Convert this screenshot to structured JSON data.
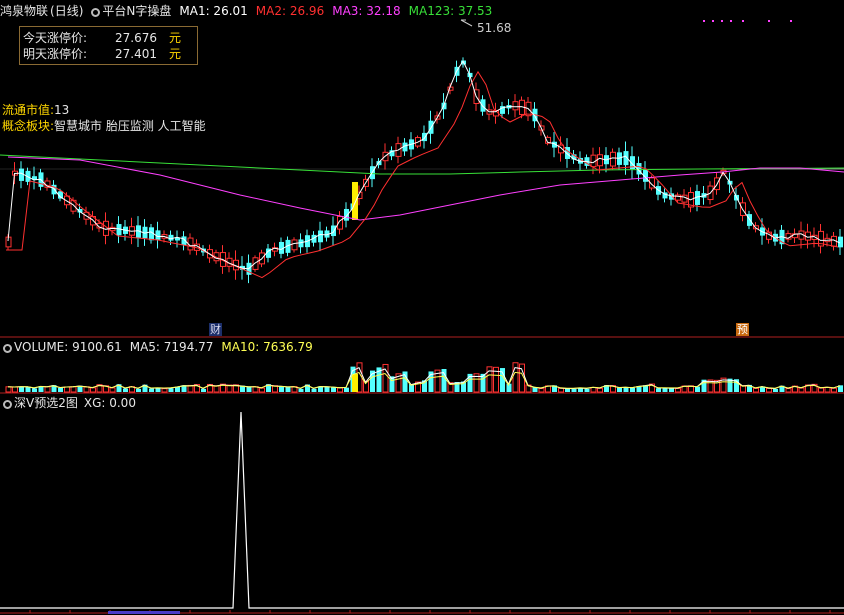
{
  "header": {
    "stock_name": "鸿泉物联",
    "period": "(日线)",
    "indicator_name": "平台N字操盘",
    "ma1": "MA1: 26.01",
    "ma2": "MA2: 26.96",
    "ma3": "MA3: 32.18",
    "ma123": "MA123: 37.53"
  },
  "limit_box": {
    "today_label": "今天涨停价:",
    "today_value": "27.676",
    "tomorrow_label": "明天涨停价:",
    "tomorrow_value": "27.401",
    "unit": "元"
  },
  "info": {
    "float_cap_label": "流通市值:",
    "float_cap_value": "13",
    "concept_label": "概念板块:",
    "concept_value": "智慧城市 胎压监测 人工智能"
  },
  "price_chart": {
    "high_label": "51.68",
    "marker_cai": "财",
    "marker_yu": "预"
  },
  "volume_panel": {
    "volume": "VOLUME: 9100.61",
    "ma5": "MA5: 7194.77",
    "ma10": "MA10: 7636.79"
  },
  "indicator_panel": {
    "name": "深V预选2图",
    "xg": "XG: 0.00"
  },
  "colors": {
    "up": "#ff3232",
    "down": "#54ffff",
    "ma1": "#ffffff",
    "ma2": "#ff3030",
    "ma3": "#ff40ff",
    "ma123": "#38e038",
    "highlight": "#ffee00",
    "border": "#b02020"
  }
}
